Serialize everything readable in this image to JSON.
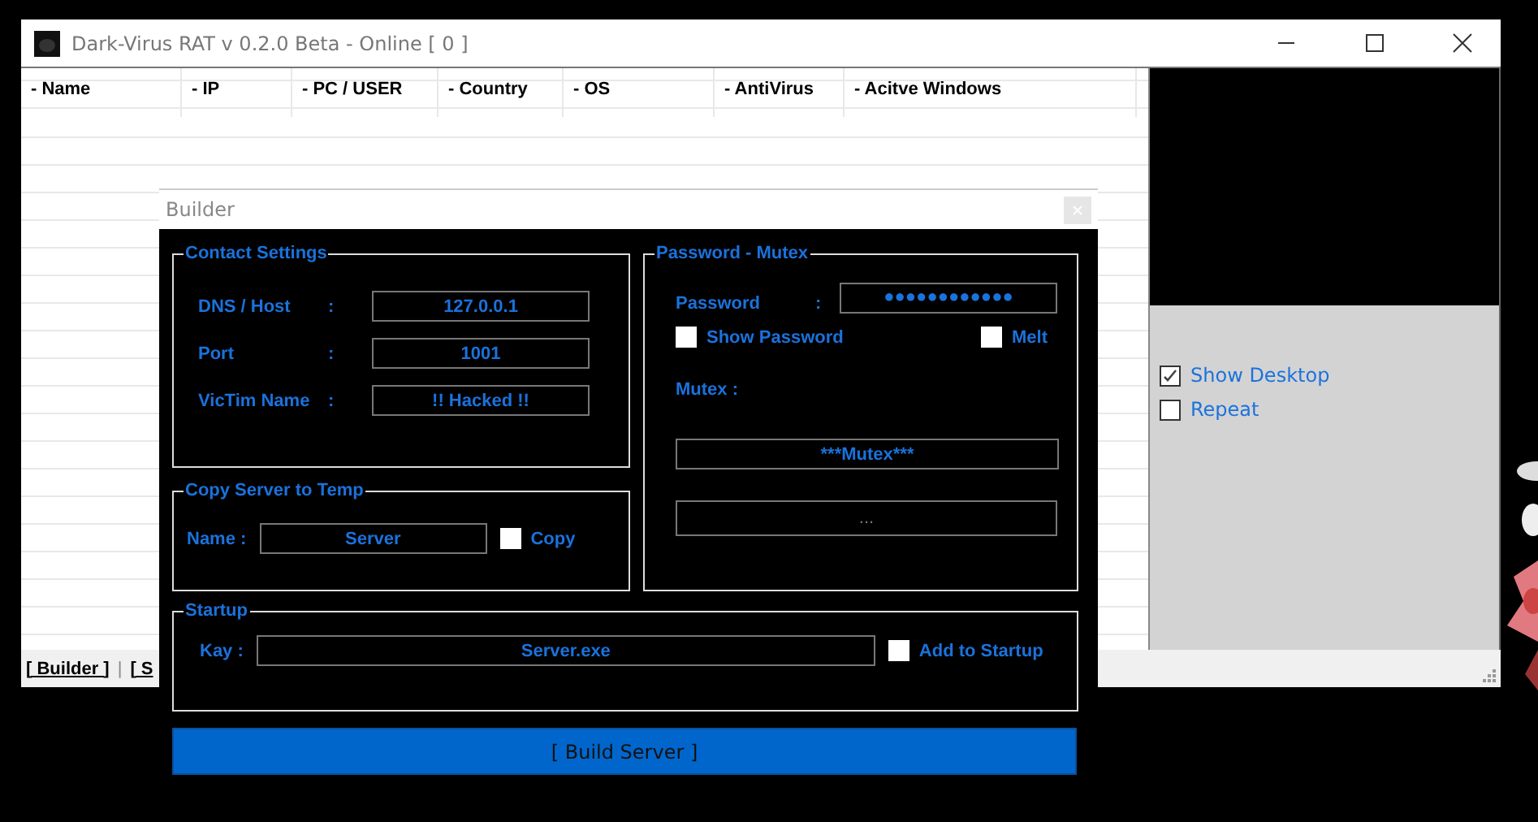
{
  "main_window": {
    "title": "Dark-Virus RAT v 0.2.0 Beta - Online [ 0 ]"
  },
  "table": {
    "columns": [
      "- Name",
      "- IP",
      "- PC / USER",
      "- Country",
      "- OS",
      "- AntiVirus",
      "- Acitve Windows"
    ]
  },
  "side_panel": {
    "options": [
      {
        "label": "Show Desktop",
        "checked": true
      },
      {
        "label": "Repeat",
        "checked": false
      }
    ]
  },
  "bottom_bar": {
    "tabs": [
      {
        "label": "[ Builder ]"
      },
      {
        "label": "[ S"
      }
    ],
    "separator": "|"
  },
  "builder": {
    "title": "Builder",
    "contact_settings": {
      "title": "Contact Settings",
      "fields": [
        {
          "label": "DNS / Host",
          "colon": ":",
          "value": "127.0.0.1"
        },
        {
          "label": "Port",
          "colon": ":",
          "value": "1001"
        },
        {
          "label": "VicTim Name",
          "colon": ":",
          "value": "!! Hacked !!"
        }
      ]
    },
    "copy_server": {
      "title": "Copy Server to Temp",
      "label": "Name :",
      "value": "Server",
      "checkbox": {
        "label": "Copy",
        "checked": false
      }
    },
    "password_mutex": {
      "title": "Password - Mutex",
      "password_label": "Password",
      "colon": ":",
      "password": "●●●●●●●●●●●●",
      "checkboxes": [
        {
          "label": "Show Password",
          "checked": false
        },
        {
          "label": "Melt",
          "checked": false
        }
      ],
      "mutex_label": "Mutex :",
      "mutex": "***Mutex***",
      "extra": "..."
    },
    "startup": {
      "title": "Startup",
      "label": "Kay :",
      "value": "Server.exe",
      "checkbox": {
        "label": "Add to Startup",
        "checked": false
      }
    },
    "build_button": "[ Build Server ]"
  }
}
